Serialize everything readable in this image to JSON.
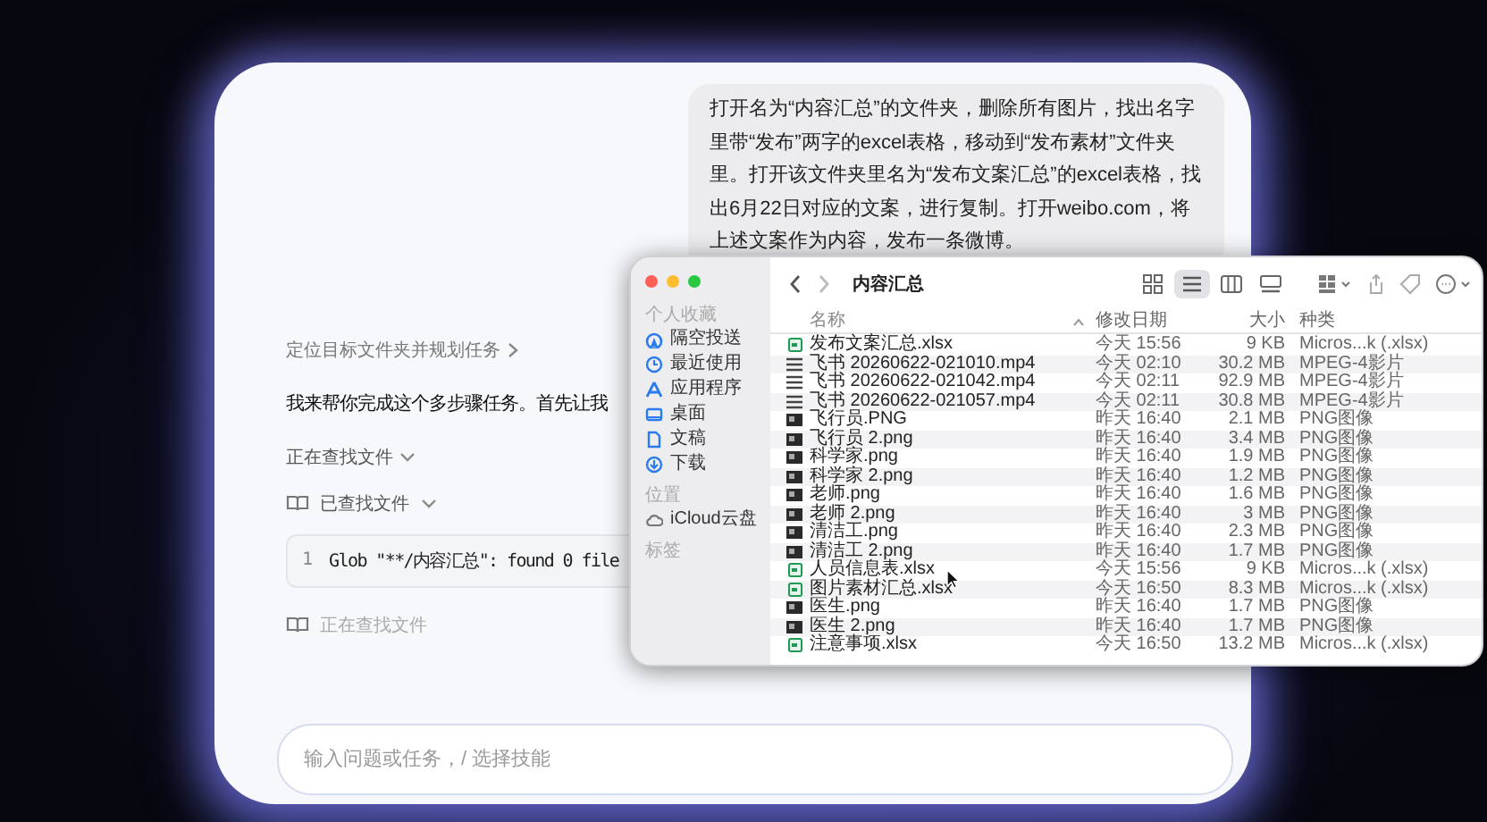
{
  "chat": {
    "user_message": "打开名为“内容汇总”的文件夹，删除所有图片，找出名字里带“发布”两字的excel表格，移动到“发布素材”文件夹里。打开该文件夹里名为“发布文案汇总”的excel表格，找出6月22日对应的文案，进行复制。打开weibo.com，将上述文案作为内容，发布一条微博。",
    "step_title": "定位目标文件夹并规划任务",
    "reply": "我来帮你完成这个多步骤任务。首先让我",
    "steps": [
      {
        "kind": "group",
        "label": "正在查找文件"
      },
      {
        "kind": "tool",
        "label": "已查找文件"
      },
      {
        "kind": "code",
        "line_number": "1",
        "text": "Glob \"**/内容汇总\": found 0 file"
      },
      {
        "kind": "pending",
        "label": "正在查找文件"
      }
    ],
    "input": {
      "placeholder": "输入问题或任务，/ 选择技能"
    }
  },
  "finder": {
    "title": "内容汇总",
    "sidebar": [
      {
        "heading": "个人收藏",
        "items": [
          {
            "label": "隔空投送"
          },
          {
            "label": "最近使用"
          },
          {
            "label": "应用程序"
          },
          {
            "label": "桌面"
          },
          {
            "label": "文稿"
          },
          {
            "label": "下载"
          }
        ]
      },
      {
        "heading": "位置",
        "items": [
          {
            "label": "iCloud云盘"
          }
        ]
      },
      {
        "heading": "标签"
      }
    ],
    "views": [
      {
        "selected": false
      },
      {
        "selected": true
      },
      {
        "selected": false
      },
      {
        "selected": false
      }
    ],
    "columns": [
      "名称",
      "修改日期",
      "大小",
      "种类"
    ],
    "files": [
      {
        "kind": "xlsx",
        "name": "发布文案汇总.xlsx",
        "modified": "今天 15:56",
        "size": "9 KB",
        "type": "Micros...k (.xlsx)"
      },
      {
        "kind": "video",
        "name": "飞书 20260622-021010.mp4",
        "modified": "今天 02:10",
        "size": "30.2 MB",
        "type": "MPEG-4影片"
      },
      {
        "kind": "video",
        "name": "飞书 20260622-021042.mp4",
        "modified": "今天 02:11",
        "size": "92.9 MB",
        "type": "MPEG-4影片"
      },
      {
        "kind": "video",
        "name": "飞书 20260622-021057.mp4",
        "modified": "今天 02:11",
        "size": "30.8 MB",
        "type": "MPEG-4影片"
      },
      {
        "kind": "image",
        "name": "飞行员.PNG",
        "modified": "昨天 16:40",
        "size": "2.1 MB",
        "type": "PNG图像"
      },
      {
        "kind": "image",
        "name": "飞行员 2.png",
        "modified": "昨天 16:40",
        "size": "3.4 MB",
        "type": "PNG图像"
      },
      {
        "kind": "image",
        "name": "科学家.png",
        "modified": "昨天 16:40",
        "size": "1.9 MB",
        "type": "PNG图像"
      },
      {
        "kind": "image",
        "name": "科学家 2.png",
        "modified": "昨天 16:40",
        "size": "1.2 MB",
        "type": "PNG图像"
      },
      {
        "kind": "image",
        "name": "老师.png",
        "modified": "昨天 16:40",
        "size": "1.6 MB",
        "type": "PNG图像"
      },
      {
        "kind": "image",
        "name": "老师 2.png",
        "modified": "昨天 16:40",
        "size": "3 MB",
        "type": "PNG图像"
      },
      {
        "kind": "image",
        "name": "清洁工.png",
        "modified": "昨天 16:40",
        "size": "2.3 MB",
        "type": "PNG图像"
      },
      {
        "kind": "image",
        "name": "清洁工 2.png",
        "modified": "昨天 16:40",
        "size": "1.7 MB",
        "type": "PNG图像"
      },
      {
        "kind": "xlsx",
        "name": "人员信息表.xlsx",
        "modified": "今天 15:56",
        "size": "9 KB",
        "type": "Micros...k (.xlsx)"
      },
      {
        "kind": "xlsx",
        "name": "图片素材汇总.xlsx",
        "modified": "今天 16:50",
        "size": "8.3 MB",
        "type": "Micros...k (.xlsx)"
      },
      {
        "kind": "image",
        "name": "医生.png",
        "modified": "昨天 16:40",
        "size": "1.7 MB",
        "type": "PNG图像"
      },
      {
        "kind": "image",
        "name": "医生 2.png",
        "modified": "昨天 16:40",
        "size": "1.7 MB",
        "type": "PNG图像"
      },
      {
        "kind": "xlsx",
        "name": "注意事项.xlsx",
        "modified": "今天 16:50",
        "size": "13.2 MB",
        "type": "Micros...k (.xlsx)"
      }
    ]
  }
}
